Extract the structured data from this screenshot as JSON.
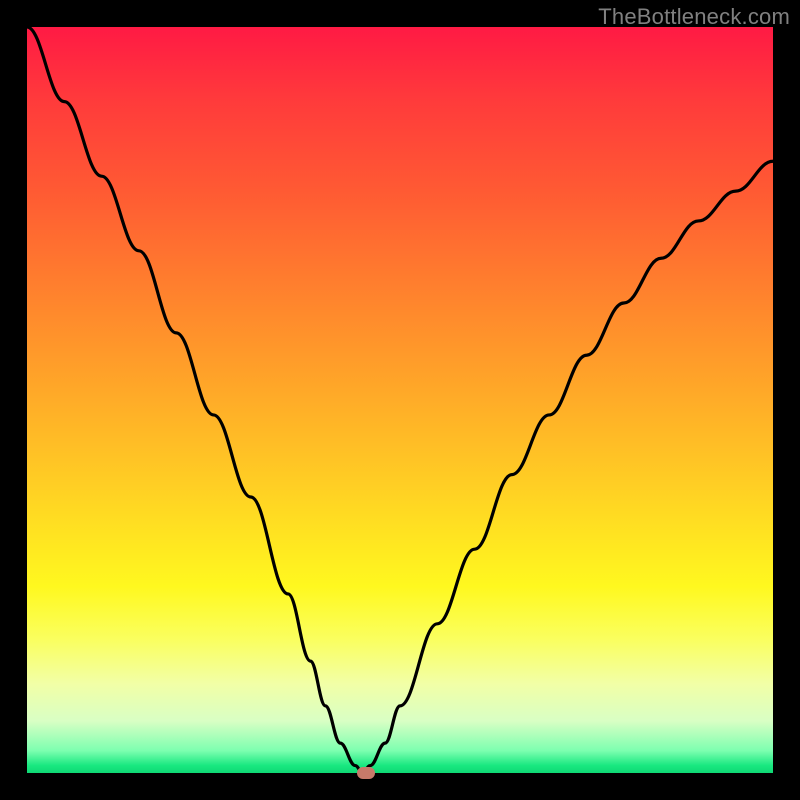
{
  "watermark": "TheBottleneck.com",
  "colors": {
    "frame": "#000000",
    "watermark": "#808080",
    "curve": "#000000",
    "marker": "#c77a6a"
  },
  "chart_data": {
    "type": "line",
    "title": "",
    "xlabel": "",
    "ylabel": "",
    "xlim": [
      0,
      100
    ],
    "ylim": [
      0,
      100
    ],
    "x": [
      0,
      5,
      10,
      15,
      20,
      25,
      30,
      35,
      38,
      40,
      42,
      44,
      45,
      46,
      48,
      50,
      55,
      60,
      65,
      70,
      75,
      80,
      85,
      90,
      95,
      100
    ],
    "values": [
      100,
      90,
      80,
      70,
      59,
      48,
      37,
      24,
      15,
      9,
      4,
      1,
      0,
      1,
      4,
      9,
      20,
      30,
      40,
      48,
      56,
      63,
      69,
      74,
      78,
      82
    ],
    "minimum": {
      "x": 45,
      "y": 0
    },
    "marker_pos": {
      "x": 45.5,
      "y": 0
    }
  }
}
